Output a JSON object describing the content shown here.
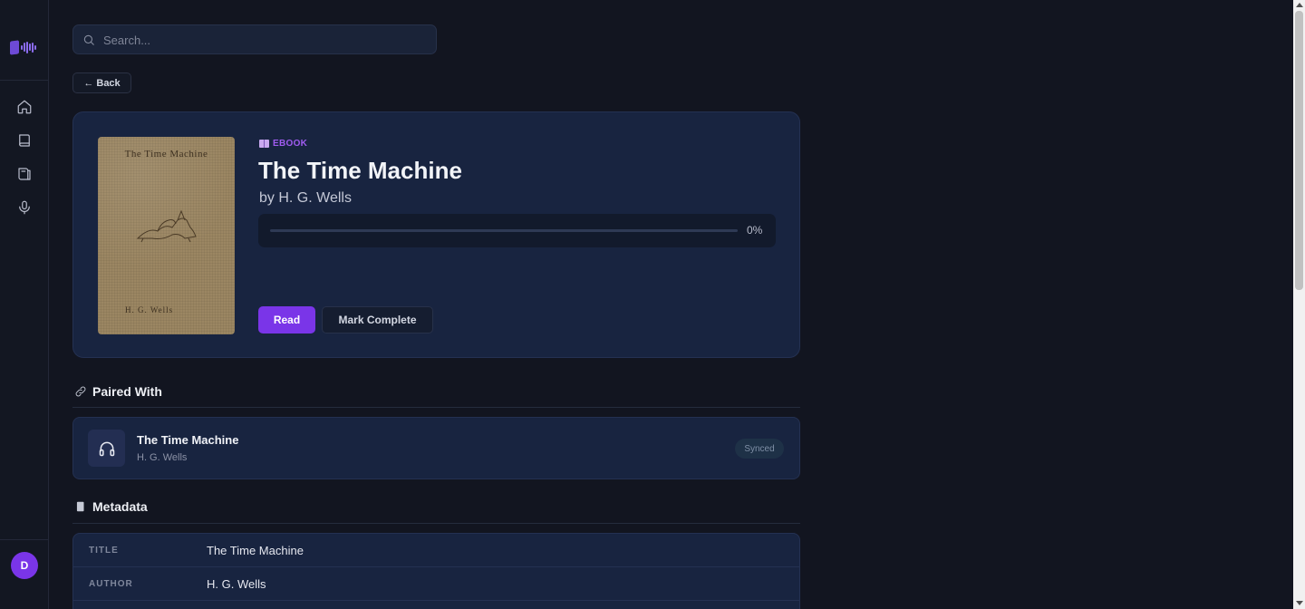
{
  "search": {
    "placeholder": "Search..."
  },
  "back_button": {
    "label": "← Back"
  },
  "book": {
    "type_label": "EBOOK",
    "title": "The Time Machine",
    "author": "by H. G. Wells",
    "cover_title": "The Time Machine",
    "cover_author": "H. G. Wells",
    "progress": 0,
    "progress_label": "0%"
  },
  "actions": {
    "read_label": "Read",
    "complete_label": "Mark Complete"
  },
  "paired": {
    "heading": "Paired With",
    "title": "The Time Machine",
    "author": "H. G. Wells",
    "status": "Synced"
  },
  "metadata": {
    "heading": "Metadata",
    "rows": [
      {
        "key": "TITLE",
        "value": "The Time Machine"
      },
      {
        "key": "AUTHOR",
        "value": "H. G. Wells"
      }
    ]
  },
  "user": {
    "initial": "D"
  },
  "colors": {
    "accent": "#7a35e8",
    "background": "#121520",
    "card": "#182440"
  }
}
